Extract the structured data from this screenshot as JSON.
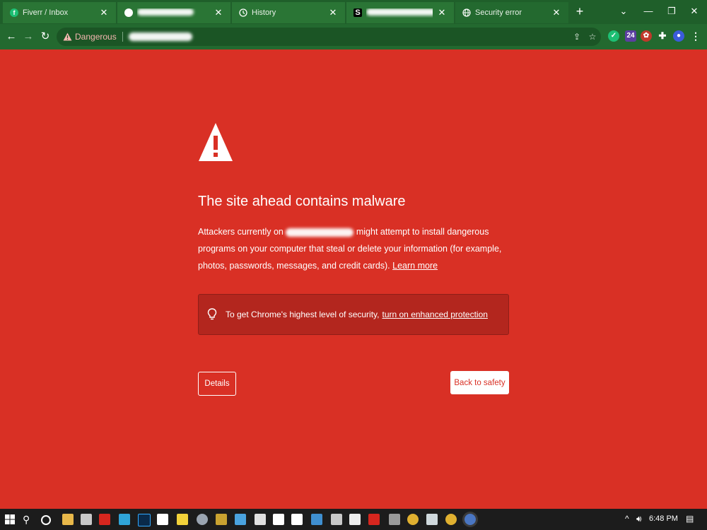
{
  "browser": {
    "tabs": [
      {
        "title": "Fiverr / Inbox",
        "favicon": "fiverr-icon",
        "favicon_char": "f",
        "favicon_color": "#1dbf73"
      },
      {
        "title": "",
        "favicon": "blurred-site-icon",
        "favicon_char": "",
        "favicon_color": "#2a7535"
      },
      {
        "title": "History",
        "favicon": "history-clock-icon",
        "favicon_char": "",
        "favicon_color": ""
      },
      {
        "title": "",
        "favicon": "s-logo-icon",
        "favicon_char": "S",
        "favicon_color": "#000000"
      },
      {
        "title": "Security error",
        "favicon": "globe-icon",
        "favicon_char": "",
        "favicon_color": ""
      }
    ],
    "omnibox": {
      "security_label": "Dangerous"
    },
    "theme_color": "#1f5f2a"
  },
  "interstitial": {
    "heading": "The site ahead contains malware",
    "body_prefix": "Attackers currently on",
    "body_suffix": "might attempt to install dangerous programs on your computer that steal or delete your information (for example, photos, passwords, messages, and credit cards).",
    "learn_more": "Learn more",
    "enhanced_text": "To get Chrome's highest level of security,",
    "enhanced_link": "turn on enhanced protection",
    "details_button": "Details",
    "safety_button": "Back to safety",
    "background_color": "#d93025"
  },
  "taskbar": {
    "time": "6:48 PM"
  }
}
